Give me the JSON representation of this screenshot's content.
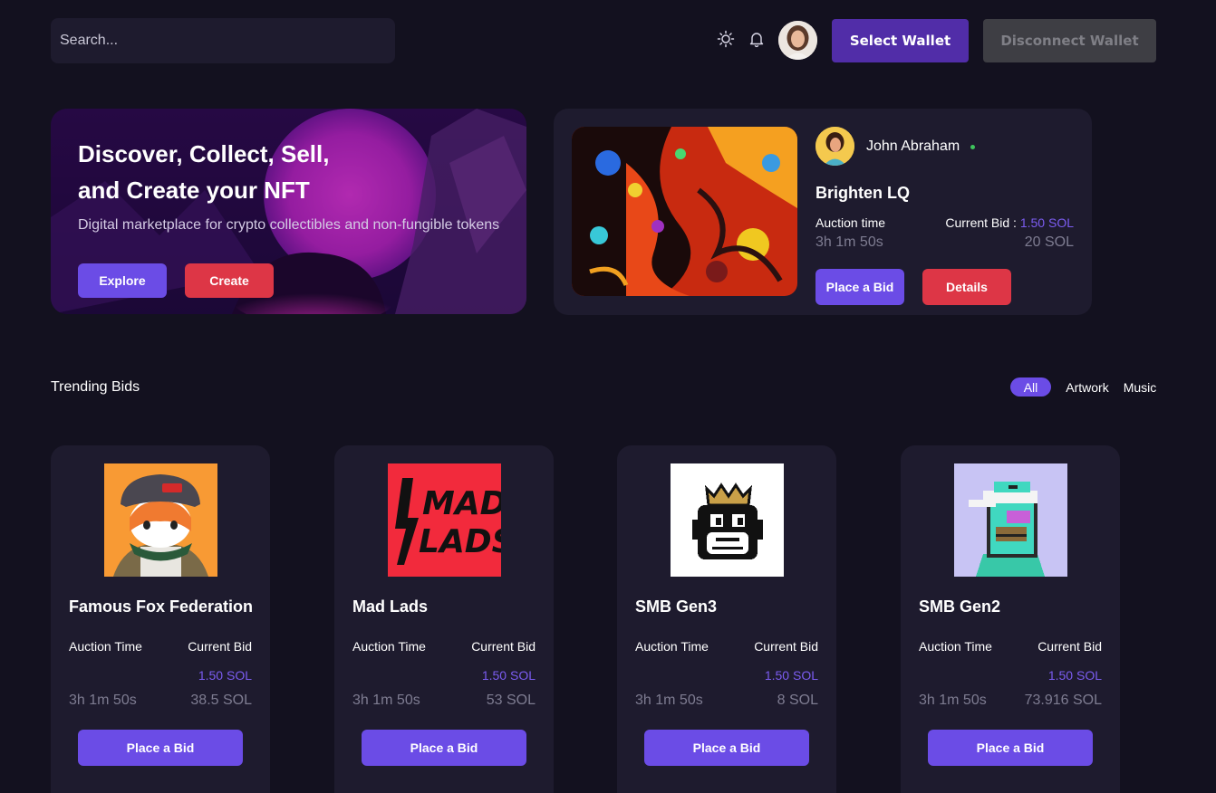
{
  "header": {
    "search_placeholder": "Search...",
    "select_wallet": "Select Wallet",
    "disconnect_wallet": "Disconnect Wallet"
  },
  "hero": {
    "title_line1": "Discover, Collect, Sell,",
    "title_line2": "and Create your NFT",
    "subtitle": "Digital marketplace for crypto collectibles and non-fungible tokens",
    "explore": "Explore",
    "create": "Create"
  },
  "featured": {
    "creator": "John Abraham",
    "title": "Brighten LQ",
    "auction_label": "Auction time",
    "bid_label": "Current Bid :",
    "bid_sol": "1.50 SOL",
    "time": "3h 1m 50s",
    "price": "20 SOL",
    "place_bid": "Place a Bid",
    "details": "Details"
  },
  "trending": {
    "title": "Trending Bids",
    "filters": [
      "All",
      "Artwork",
      "Music"
    ],
    "active_filter": "All",
    "cards": [
      {
        "title": "Famous Fox Federation",
        "auction_label": "Auction Time",
        "bid_label": "Current Bid",
        "sol": "1.50 SOL",
        "time": "3h 1m 50s",
        "price": "38.5 SOL",
        "button": "Place a Bid"
      },
      {
        "title": "Mad Lads",
        "auction_label": "Auction Time",
        "bid_label": "Current Bid",
        "sol": "1.50 SOL",
        "time": "3h 1m 50s",
        "price": "53 SOL",
        "button": "Place a Bid"
      },
      {
        "title": "SMB Gen3",
        "auction_label": "Auction Time",
        "bid_label": "Current Bid",
        "sol": "1.50 SOL",
        "time": "3h 1m 50s",
        "price": "8 SOL",
        "button": "Place a Bid"
      },
      {
        "title": "SMB Gen2",
        "auction_label": "Auction Time",
        "bid_label": "Current Bid",
        "sol": "1.50 SOL",
        "time": "3h 1m 50s",
        "price": "73.916 SOL",
        "button": "Place a Bid"
      }
    ]
  },
  "images": {
    "madlads_logo_line1": "MAD",
    "madlads_logo_line2": "LADS"
  },
  "colors": {
    "background": "#13111f",
    "card": "#1e1b2e",
    "accent_purple": "#6b4ce6",
    "wallet_purple": "#512da8",
    "accent_red": "#dd3646",
    "sol_text": "#7b5cf0",
    "muted_text": "#7e7c91",
    "online": "#3ec45c"
  }
}
